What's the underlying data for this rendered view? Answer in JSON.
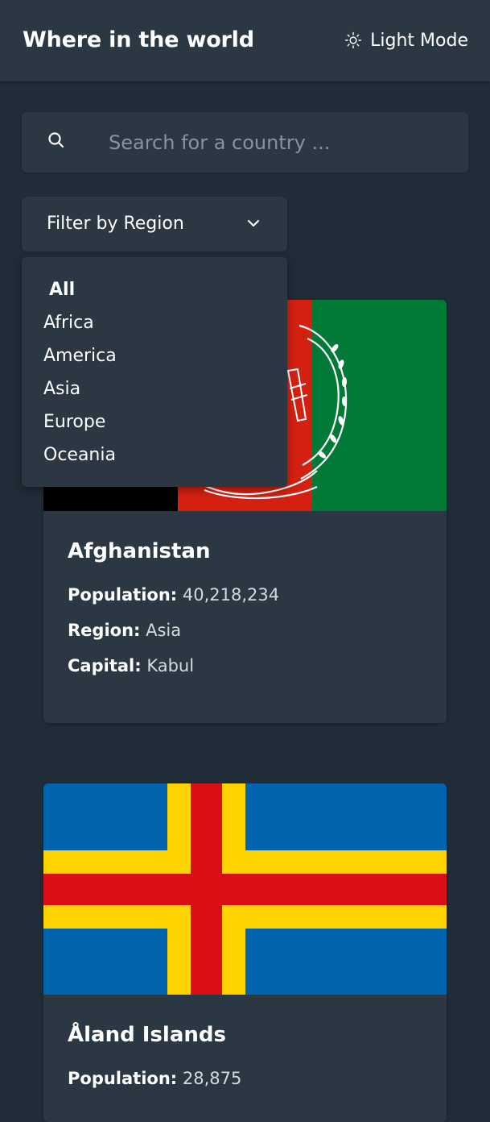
{
  "header": {
    "title": "Where in the world",
    "theme_toggle_label": "Light Mode"
  },
  "search": {
    "placeholder": "Search for a country ...",
    "value": ""
  },
  "filter": {
    "label": "Filter by Region",
    "selected": "All",
    "options": [
      "All",
      "Africa",
      "America",
      "Asia",
      "Europe",
      "Oceania"
    ]
  },
  "countries": [
    {
      "name": "Afghanistan",
      "flag_icon": "afghanistan-flag",
      "population_label": "Population:",
      "population": "40,218,234",
      "region_label": "Region:",
      "region": "Asia",
      "capital_label": "Capital:",
      "capital": "Kabul"
    },
    {
      "name": "Åland Islands",
      "flag_icon": "aland-islands-flag",
      "population_label": "Population:",
      "population": "28,875"
    }
  ],
  "colors": {
    "background": "#202c37",
    "surface": "#2b3743",
    "text": "#ffffff",
    "placeholder": "#8a939b"
  }
}
